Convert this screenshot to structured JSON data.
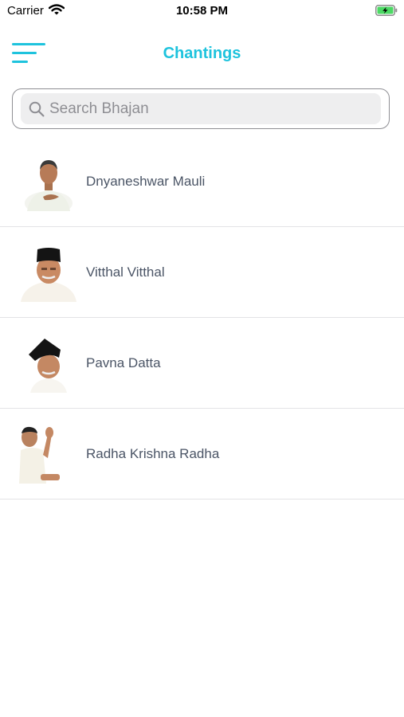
{
  "status_bar": {
    "carrier": "Carrier",
    "time": "10:58 PM",
    "wifi_icon": "wifi-icon",
    "battery_icon": "battery-charging-icon",
    "battery_color": "#4cd964"
  },
  "nav": {
    "title": "Chantings",
    "menu_icon": "hamburger-menu-icon",
    "accent_color": "#1ec3dd"
  },
  "search": {
    "placeholder": "Search Bhajan",
    "value": ""
  },
  "bhajans": [
    {
      "name": "Dnyaneshwar Mauli",
      "avatar_icon": "portrait-icon"
    },
    {
      "name": "Vitthal Vitthal",
      "avatar_icon": "portrait-icon"
    },
    {
      "name": "Pavna Datta",
      "avatar_icon": "portrait-icon"
    },
    {
      "name": "Radha Krishna Radha",
      "avatar_icon": "portrait-icon"
    }
  ]
}
